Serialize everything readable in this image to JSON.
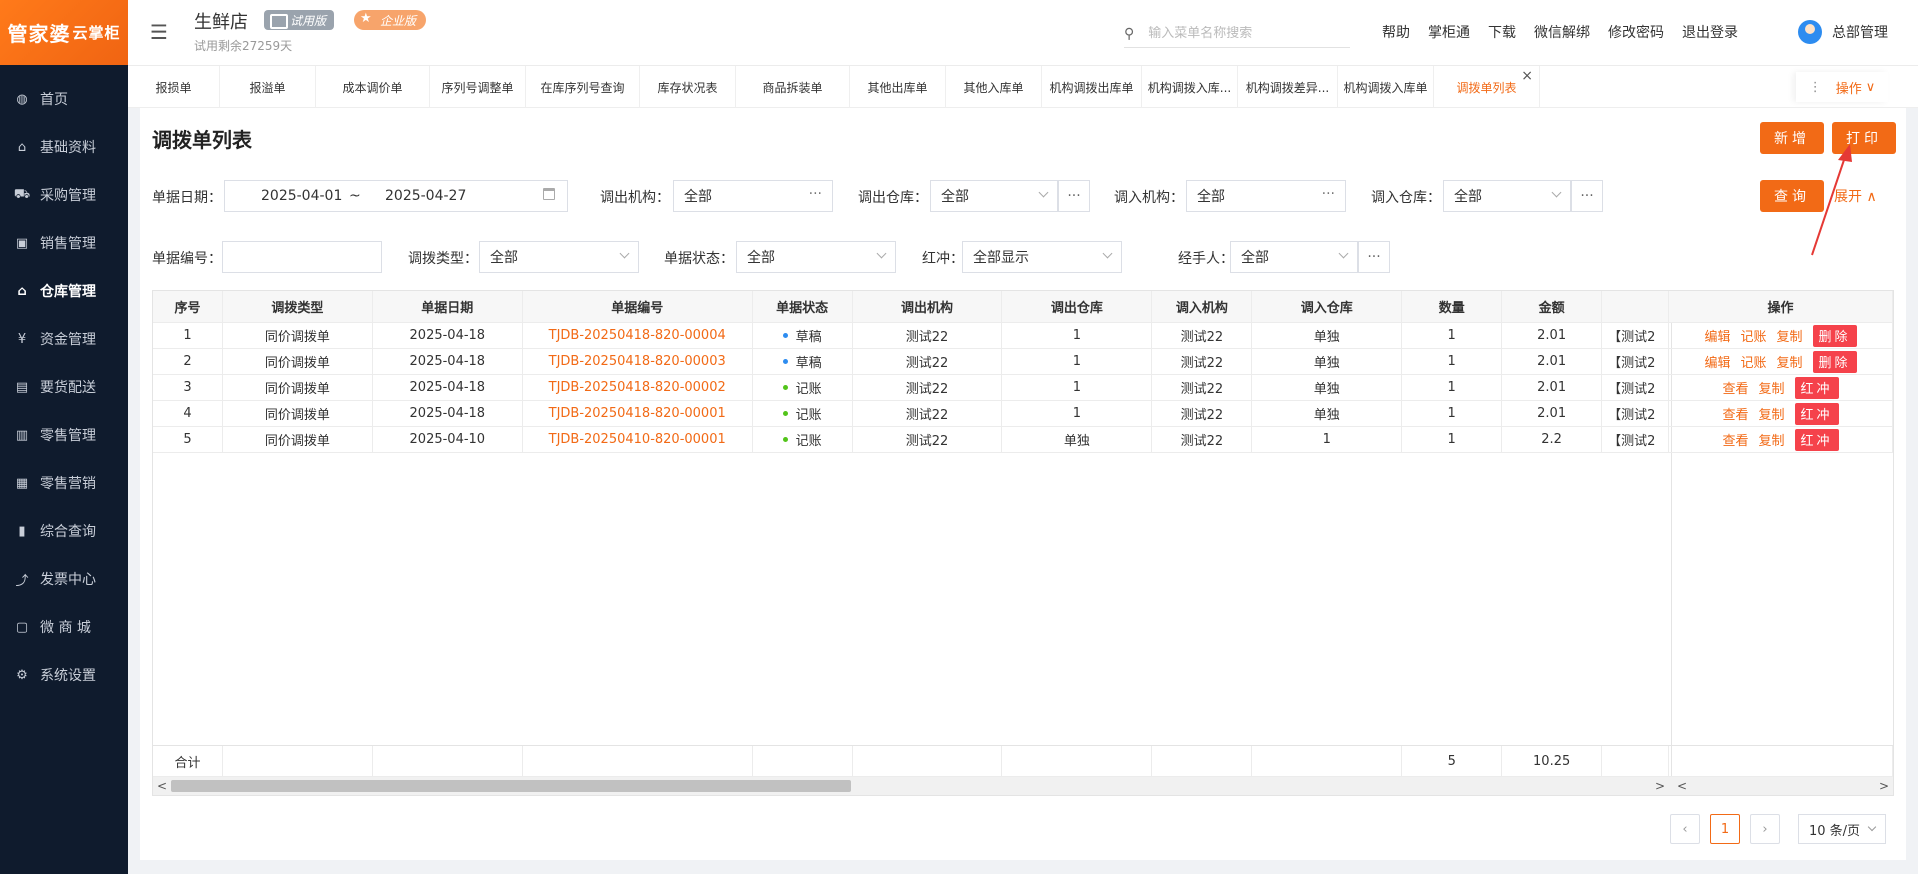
{
  "sidebar": {
    "logo_main": "管家婆",
    "logo_sub": "云掌柜",
    "items": [
      {
        "label": "首页",
        "icon": "globe-icon"
      },
      {
        "label": "基础资料",
        "icon": "home-icon"
      },
      {
        "label": "采购管理",
        "icon": "cart-icon"
      },
      {
        "label": "销售管理",
        "icon": "sales-icon"
      },
      {
        "label": "仓库管理",
        "icon": "warehouse-icon"
      },
      {
        "label": "资金管理",
        "icon": "money-icon"
      },
      {
        "label": "要货配送",
        "icon": "delivery-icon"
      },
      {
        "label": "零售管理",
        "icon": "retail-icon"
      },
      {
        "label": "零售营销",
        "icon": "gift-icon"
      },
      {
        "label": "综合查询",
        "icon": "report-icon"
      },
      {
        "label": "发票中心",
        "icon": "invoice-icon"
      },
      {
        "label": "微 商 城",
        "icon": "shop-icon"
      },
      {
        "label": "系统设置",
        "icon": "settings-icon"
      }
    ]
  },
  "header": {
    "store_name": "生鲜店",
    "badge_trial": "试用版",
    "badge_enterprise": "企业版",
    "trial_days": "试用剩余27259天",
    "search_placeholder": "输入菜单名称搜索",
    "links": [
      "帮助",
      "掌柜通",
      "下载",
      "微信解绑",
      "修改密码",
      "退出登录"
    ],
    "user": "总部管理"
  },
  "tabs": {
    "items": [
      "报损单",
      "报溢单",
      "成本调价单",
      "序列号调整单",
      "在库序列号查询",
      "库存状况表",
      "商品拆装单",
      "其他出库单",
      "其他入库单",
      "机构调拨出库单",
      "机构调拨入库...",
      "机构调拨差异...",
      "机构调拨入库单",
      "调拨单列表"
    ],
    "active": "调拨单列表",
    "more": "操作"
  },
  "page": {
    "title": "调拨单列表",
    "new_btn": "新增",
    "print_btn": "打印",
    "query_btn": "查询",
    "expand": "展开"
  },
  "filters": {
    "date_label": "单据日期",
    "date_from": "2025-04-01",
    "date_sep": "~",
    "date_to": "2025-04-27",
    "out_org_label": "调出机构",
    "out_org": "全部",
    "out_wh_label": "调出仓库",
    "out_wh": "全部",
    "in_org_label": "调入机构",
    "in_org": "全部",
    "in_wh_label": "调入仓库",
    "in_wh": "全部",
    "code_label": "单据编号",
    "code": "",
    "type_label": "调拨类型",
    "type": "全部",
    "status_label": "单据状态",
    "status": "全部",
    "redflush_label": "红冲",
    "redflush": "全部显示",
    "handler_label": "经手人",
    "handler": "全部"
  },
  "table": {
    "headers": [
      "序号",
      "调拨类型",
      "单据日期",
      "单据编号",
      "单据状态",
      "调出机构",
      "调出仓库",
      "调入机构",
      "调入仓库",
      "数量",
      "金额",
      "",
      "操作"
    ],
    "rows": [
      {
        "no": "1",
        "type": "同价调拨单",
        "date": "2025-04-18",
        "code": "TJDB-20250418-820-00004",
        "status": "草稿",
        "status_color": "#2d8cf0",
        "out_org": "测试22",
        "out_wh": "1",
        "in_org": "测试22",
        "in_wh": "单独",
        "qty": "1",
        "amount": "2.01",
        "remark": "【测试2",
        "ops": [
          "编辑",
          "记账",
          "复制"
        ],
        "op_btn": "删除"
      },
      {
        "no": "2",
        "type": "同价调拨单",
        "date": "2025-04-18",
        "code": "TJDB-20250418-820-00003",
        "status": "草稿",
        "status_color": "#2d8cf0",
        "out_org": "测试22",
        "out_wh": "1",
        "in_org": "测试22",
        "in_wh": "单独",
        "qty": "1",
        "amount": "2.01",
        "remark": "【测试2",
        "ops": [
          "编辑",
          "记账",
          "复制"
        ],
        "op_btn": "删除"
      },
      {
        "no": "3",
        "type": "同价调拨单",
        "date": "2025-04-18",
        "code": "TJDB-20250418-820-00002",
        "status": "记账",
        "status_color": "#52c41a",
        "out_org": "测试22",
        "out_wh": "1",
        "in_org": "测试22",
        "in_wh": "单独",
        "qty": "1",
        "amount": "2.01",
        "remark": "【测试2",
        "ops": [
          "查看",
          "复制"
        ],
        "op_btn": "红冲"
      },
      {
        "no": "4",
        "type": "同价调拨单",
        "date": "2025-04-18",
        "code": "TJDB-20250418-820-00001",
        "status": "记账",
        "status_color": "#52c41a",
        "out_org": "测试22",
        "out_wh": "1",
        "in_org": "测试22",
        "in_wh": "单独",
        "qty": "1",
        "amount": "2.01",
        "remark": "【测试2",
        "ops": [
          "查看",
          "复制"
        ],
        "op_btn": "红冲"
      },
      {
        "no": "5",
        "type": "同价调拨单",
        "date": "2025-04-10",
        "code": "TJDB-20250410-820-00001",
        "status": "记账",
        "status_color": "#52c41a",
        "out_org": "测试22",
        "out_wh": "单独",
        "in_org": "测试22",
        "in_wh": "1",
        "qty": "1",
        "amount": "2.2",
        "remark": "【测试2",
        "ops": [
          "查看",
          "复制"
        ],
        "op_btn": "红冲"
      }
    ],
    "total_label": "合计",
    "total_qty": "5",
    "total_amount": "10.25"
  },
  "pagination": {
    "current": "1",
    "page_size": "10 条/页"
  },
  "colors": {
    "accent": "#f26a16",
    "danger": "#f5424b",
    "sidebar_bg": "#0f1b2d"
  }
}
